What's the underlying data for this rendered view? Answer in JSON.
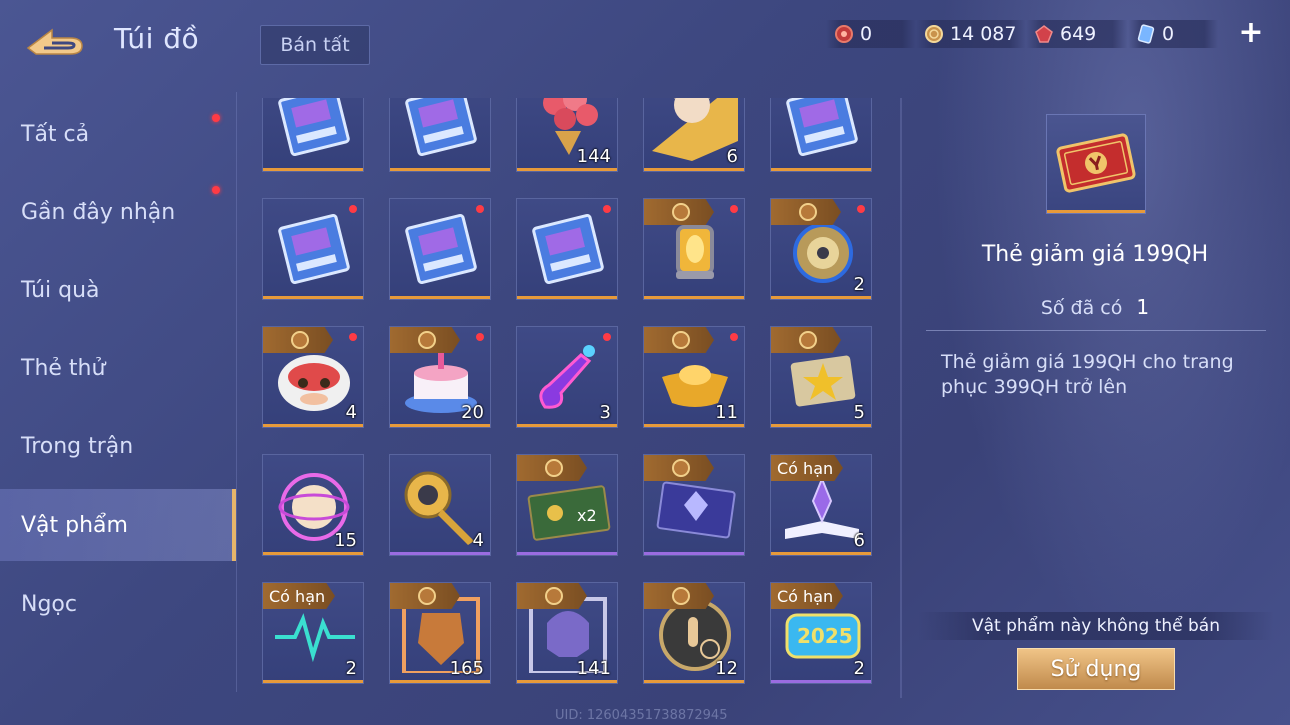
{
  "header": {
    "title": "Túi đồ",
    "sell_all_label": "Bán tất",
    "currencies": [
      {
        "icon": "red-token-icon",
        "value": "0"
      },
      {
        "icon": "gold-coin-icon",
        "value": "14 087"
      },
      {
        "icon": "red-gem-icon",
        "value": "649"
      },
      {
        "icon": "blue-voucher-icon",
        "value": "0"
      }
    ],
    "add_label": "+"
  },
  "sidebar": {
    "tabs": [
      {
        "label": "Tất cả",
        "dot": true,
        "active": false
      },
      {
        "label": "Gần đây nhận",
        "dot": true,
        "active": false
      },
      {
        "label": "Túi quà",
        "dot": false,
        "active": false
      },
      {
        "label": "Thẻ thử",
        "dot": false,
        "active": false
      },
      {
        "label": "Trong trận",
        "dot": false,
        "active": false
      },
      {
        "label": "Vật phẩm",
        "dot": false,
        "active": true
      },
      {
        "label": "Ngọc",
        "dot": false,
        "active": false
      }
    ]
  },
  "items": [
    {
      "icon": "blue-ticket-icon",
      "count": "",
      "badge": "",
      "dot": false,
      "bar": "orange"
    },
    {
      "icon": "blue-ticket-icon",
      "count": "",
      "badge": "",
      "dot": false,
      "bar": "orange"
    },
    {
      "icon": "rose-bouquet-icon",
      "count": "144",
      "badge": "",
      "dot": false,
      "bar": "orange"
    },
    {
      "icon": "hero-portrait-icon",
      "count": "6",
      "badge": "",
      "dot": false,
      "bar": "orange"
    },
    {
      "icon": "blue-ticket-icon",
      "count": "",
      "badge": "",
      "dot": false,
      "bar": "orange"
    },
    {
      "icon": "blue-ticket-icon",
      "count": "",
      "badge": "",
      "dot": true,
      "bar": "orange"
    },
    {
      "icon": "blue-ticket-icon",
      "count": "",
      "badge": "",
      "dot": true,
      "bar": "orange"
    },
    {
      "icon": "blue-ticket-icon",
      "count": "",
      "badge": "",
      "dot": true,
      "bar": "orange"
    },
    {
      "icon": "golden-lantern-icon",
      "count": "",
      "badge": "coin",
      "dot": true,
      "bar": "orange"
    },
    {
      "icon": "spiral-orb-icon",
      "count": "2",
      "badge": "coin",
      "dot": true,
      "bar": "orange"
    },
    {
      "icon": "lion-dance-icon",
      "count": "4",
      "badge": "coin",
      "dot": true,
      "bar": "orange"
    },
    {
      "icon": "cake-icon",
      "count": "20",
      "badge": "coin",
      "dot": true,
      "bar": "orange"
    },
    {
      "icon": "neon-guitar-icon",
      "count": "3",
      "badge": "",
      "dot": true,
      "bar": "orange"
    },
    {
      "icon": "gold-ingot-icon",
      "count": "11",
      "badge": "coin",
      "dot": true,
      "bar": "orange"
    },
    {
      "icon": "star-ticket-icon",
      "count": "5",
      "badge": "coin",
      "dot": false,
      "bar": "orange"
    },
    {
      "icon": "glowing-orb-icon",
      "count": "15",
      "badge": "",
      "dot": false,
      "bar": "orange"
    },
    {
      "icon": "golden-horn-icon",
      "count": "4",
      "badge": "",
      "dot": false,
      "bar": "purple"
    },
    {
      "icon": "double-exp-card-icon",
      "count": "",
      "badge": "coin",
      "dot": false,
      "bar": "purple"
    },
    {
      "icon": "crystal-card-icon",
      "count": "",
      "badge": "coin",
      "dot": false,
      "bar": "purple"
    },
    {
      "icon": "magic-book-icon",
      "count": "6",
      "badge": "Có hạn",
      "dot": false,
      "bar": "orange"
    },
    {
      "icon": "heartbeat-icon",
      "count": "2",
      "badge": "Có hạn",
      "dot": false,
      "bar": "orange"
    },
    {
      "icon": "armor-frame-icon",
      "count": "165",
      "badge": "coin",
      "dot": false,
      "bar": "orange"
    },
    {
      "icon": "helmet-frame-icon",
      "count": "141",
      "badge": "coin",
      "dot": false,
      "bar": "orange"
    },
    {
      "icon": "tap-badge-icon",
      "count": "12",
      "badge": "coin",
      "dot": false,
      "bar": "orange"
    },
    {
      "icon": "2025-badge-icon",
      "count": "2",
      "badge": "Có hạn",
      "dot": false,
      "bar": "purple"
    }
  ],
  "detail": {
    "icon": "red-discount-ticket-icon",
    "name": "Thẻ giảm giá 199QH",
    "owned_label": "Số đã có",
    "owned_value": "1",
    "description": "Thẻ giảm giá 199QH cho trang phục 399QH trở lên",
    "not_sellable": "Vật phẩm này không thể bán",
    "use_label": "Sử dụng"
  },
  "uid": "UID: 12604351738872945"
}
